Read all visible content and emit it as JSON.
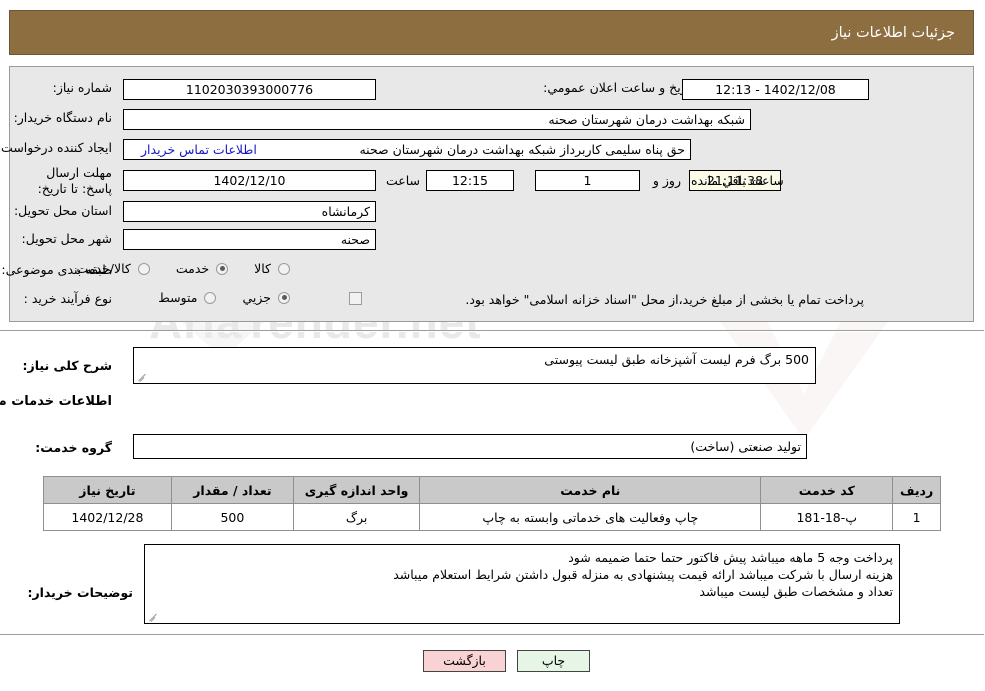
{
  "header": {
    "title": "جزئیات اطلاعات نیاز",
    "bar_color": "#8d6e41"
  },
  "info": {
    "need_number_label": "شماره نیاز:",
    "need_number_value": "1102030393000776",
    "announce_label": "تاریخ و ساعت اعلان عمومي:",
    "announce_value": "1402/12/08 - 12:13",
    "buyer_org_label": "نام دستگاه خریدار:",
    "buyer_org_value": "شبکه بهداشت درمان شهرستان صحنه",
    "creator_label": "ایجاد کننده درخواست:",
    "creator_value": "حق پناه سلیمی کاربرداز شبکه بهداشت درمان شهرستان صحنه",
    "contact_link": "اطلاعات تماس خریدار",
    "deadline_label": "مهلت ارسال پاسخ: تا تاریخ:",
    "deadline_date": "1402/12/10",
    "hour_label": "ساعت",
    "deadline_time": "12:15",
    "days_value": "1",
    "days_label": "روز و",
    "countdown_value": "21:11:38",
    "countdown_label": "ساعت باقي مانده",
    "province_label": "استان محل تحویل:",
    "province_value": "کرمانشاه",
    "city_label": "شهر محل تحویل:",
    "city_value": "صحنه",
    "category_label": "طبقه بندی موضوعی:",
    "category_options": [
      {
        "label": "کالا",
        "checked": false
      },
      {
        "label": "خدمت",
        "checked": true
      },
      {
        "label": "کالا/خدمت",
        "checked": false
      }
    ],
    "process_label": "نوع فرآیند خرید :",
    "process_options": [
      {
        "label": "جزیي",
        "checked": true
      },
      {
        "label": "متوسط",
        "checked": false
      }
    ],
    "treasury_checkbox_text": "پرداخت تمام یا بخشی از مبلغ خرید،از محل \"اسناد خزانه اسلامی\" خواهد بود.",
    "treasury_checked": false
  },
  "general": {
    "need_desc_label": "شرح کلی نیاز:",
    "need_desc_value": "500 برگ فرم لیست آشپزخانه طبق لیست پیوستی",
    "services_section_title": "اطلاعات خدمات مورد نیاز",
    "service_group_label": "گروه خدمت:",
    "service_group_value": "تولید صنعتی (ساخت)"
  },
  "table": {
    "columns": [
      "ردیف",
      "کد خدمت",
      "نام خدمت",
      "واحد اندازه گیری",
      "تعداد / مقدار",
      "تاریخ نیاز"
    ],
    "rows": [
      {
        "index": "1",
        "code": "پ-18-181",
        "name": "چاپ وفعالیت های خدماتی وابسته به چاپ",
        "unit": "برگ",
        "quantity": "500",
        "need_date": "1402/12/28"
      }
    ]
  },
  "notes": {
    "label": "توضیحات خریدار:",
    "lines": [
      "پرداخت وجه 5 ماهه میباشد  پیش فاکتور حتما حتما ضمیمه شود",
      "هزینه ارسال با شرکت میباشد  ارائه قیمت پیشنهادی به منزله قبول داشتن شرایط استعلام میباشد",
      "تعداد و مشخصات طبق لیست میباشد"
    ]
  },
  "footer": {
    "print_label": "چاپ",
    "back_label": "بازگشت"
  },
  "watermark": {
    "text": "AriaTender.net"
  }
}
